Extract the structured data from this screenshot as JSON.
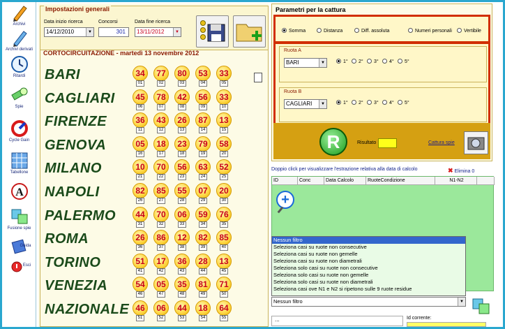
{
  "sidebar": {
    "items": [
      {
        "label": "Archivi"
      },
      {
        "label": "Archivi derivati"
      },
      {
        "label": "Ritardi"
      },
      {
        "label": "Spie"
      },
      {
        "label": "Cycle Gain"
      },
      {
        "label": "Tabellone"
      },
      {
        "label": ""
      },
      {
        "label": "Fusione spie"
      },
      {
        "label": "Guida"
      },
      {
        "label": "Esci"
      }
    ]
  },
  "general": {
    "title": "Impostazioni generali",
    "start_label": "Data inizio ricerca",
    "start_value": "14/12/2010",
    "concorsi_label": "Concorsi",
    "concorsi_value": "301",
    "end_label": "Data fine ricerca",
    "end_value": "13/11/2012"
  },
  "cortocircuit": {
    "title": "CORTOCIRCUITAZIONE - martedì 13 novembre 2012",
    "rows": [
      {
        "city": "BARI",
        "balls": [
          [
            "34",
            "01"
          ],
          [
            "77",
            "02"
          ],
          [
            "80",
            "03"
          ],
          [
            "53",
            "04"
          ],
          [
            "33",
            "05"
          ]
        ]
      },
      {
        "city": "CAGLIARI",
        "balls": [
          [
            "45",
            "06"
          ],
          [
            "78",
            "07"
          ],
          [
            "42",
            "08"
          ],
          [
            "56",
            "09"
          ],
          [
            "33",
            "10"
          ]
        ]
      },
      {
        "city": "FIRENZE",
        "balls": [
          [
            "36",
            "11"
          ],
          [
            "43",
            "12"
          ],
          [
            "26",
            "13"
          ],
          [
            "87",
            "14"
          ],
          [
            "13",
            "15"
          ]
        ]
      },
      {
        "city": "GENOVA",
        "balls": [
          [
            "05",
            "16"
          ],
          [
            "18",
            "17"
          ],
          [
            "23",
            "18"
          ],
          [
            "79",
            "19"
          ],
          [
            "58",
            "20"
          ]
        ]
      },
      {
        "city": "MILANO",
        "balls": [
          [
            "10",
            "21"
          ],
          [
            "70",
            "22"
          ],
          [
            "56",
            "23"
          ],
          [
            "63",
            "24"
          ],
          [
            "52",
            "25"
          ]
        ]
      },
      {
        "city": "NAPOLI",
        "balls": [
          [
            "82",
            "26"
          ],
          [
            "85",
            "27"
          ],
          [
            "55",
            "28"
          ],
          [
            "07",
            "29"
          ],
          [
            "20",
            "30"
          ]
        ]
      },
      {
        "city": "PALERMO",
        "balls": [
          [
            "44",
            "31"
          ],
          [
            "70",
            "32"
          ],
          [
            "06",
            "33"
          ],
          [
            "59",
            "34"
          ],
          [
            "76",
            "35"
          ]
        ]
      },
      {
        "city": "ROMA",
        "balls": [
          [
            "26",
            "36"
          ],
          [
            "86",
            "37"
          ],
          [
            "12",
            "38"
          ],
          [
            "82",
            "39"
          ],
          [
            "85",
            "40"
          ]
        ]
      },
      {
        "city": "TORINO",
        "balls": [
          [
            "51",
            "41"
          ],
          [
            "17",
            "42"
          ],
          [
            "36",
            "43"
          ],
          [
            "28",
            "44"
          ],
          [
            "13",
            "45"
          ]
        ]
      },
      {
        "city": "VENEZIA",
        "balls": [
          [
            "54",
            "46"
          ],
          [
            "05",
            "47"
          ],
          [
            "35",
            "48"
          ],
          [
            "81",
            "49"
          ],
          [
            "71",
            "50"
          ]
        ]
      },
      {
        "city": "NAZIONALE",
        "balls": [
          [
            "46",
            "51"
          ],
          [
            "06",
            "52"
          ],
          [
            "44",
            "53"
          ],
          [
            "18",
            "54"
          ],
          [
            "64",
            "55"
          ]
        ]
      }
    ]
  },
  "params": {
    "title": "Parametri per la cattura",
    "modes": [
      "Somma",
      "Distanza",
      "Diff. assoluta",
      "Numeri personali",
      "Vertibile"
    ],
    "mode_selected": 0,
    "ruota_a": {
      "label": "Ruota A",
      "value": "BARI"
    },
    "ruota_b": {
      "label": "Ruota B",
      "value": "CAGLIARI"
    },
    "positions": [
      "1°",
      "2°",
      "3°",
      "4°",
      "5°"
    ],
    "pos_selected": 0,
    "result_label": "Risultato",
    "capture_label": "Cattura spie"
  },
  "list": {
    "hint": "Doppio click per visualizzare l'estrazione relativa alla data di calcolo",
    "elimina": "Elimina 0",
    "columns": [
      "ID",
      "Conc",
      "Data Calcolo",
      "RuoteCondizione",
      "N1-N2"
    ],
    "filter_options": [
      "Nessun filtro",
      "Seleziona casi su ruote non consecutive",
      "Seleziona casi su ruote non gemelle",
      "Seleziona casi su ruote non diametrali",
      "Seleziona solo casi su ruote non consecutive",
      "Seleziona solo casi su ruote non gemelle",
      "Seleziona solo casi su ruote non diametrali",
      "Seleziona casi ove N1 e N2 si ripetono sulle 9 ruote residue"
    ],
    "filter_value": "Nessun filtro",
    "bottom_text": "...",
    "id_label": "Id corrente:"
  }
}
